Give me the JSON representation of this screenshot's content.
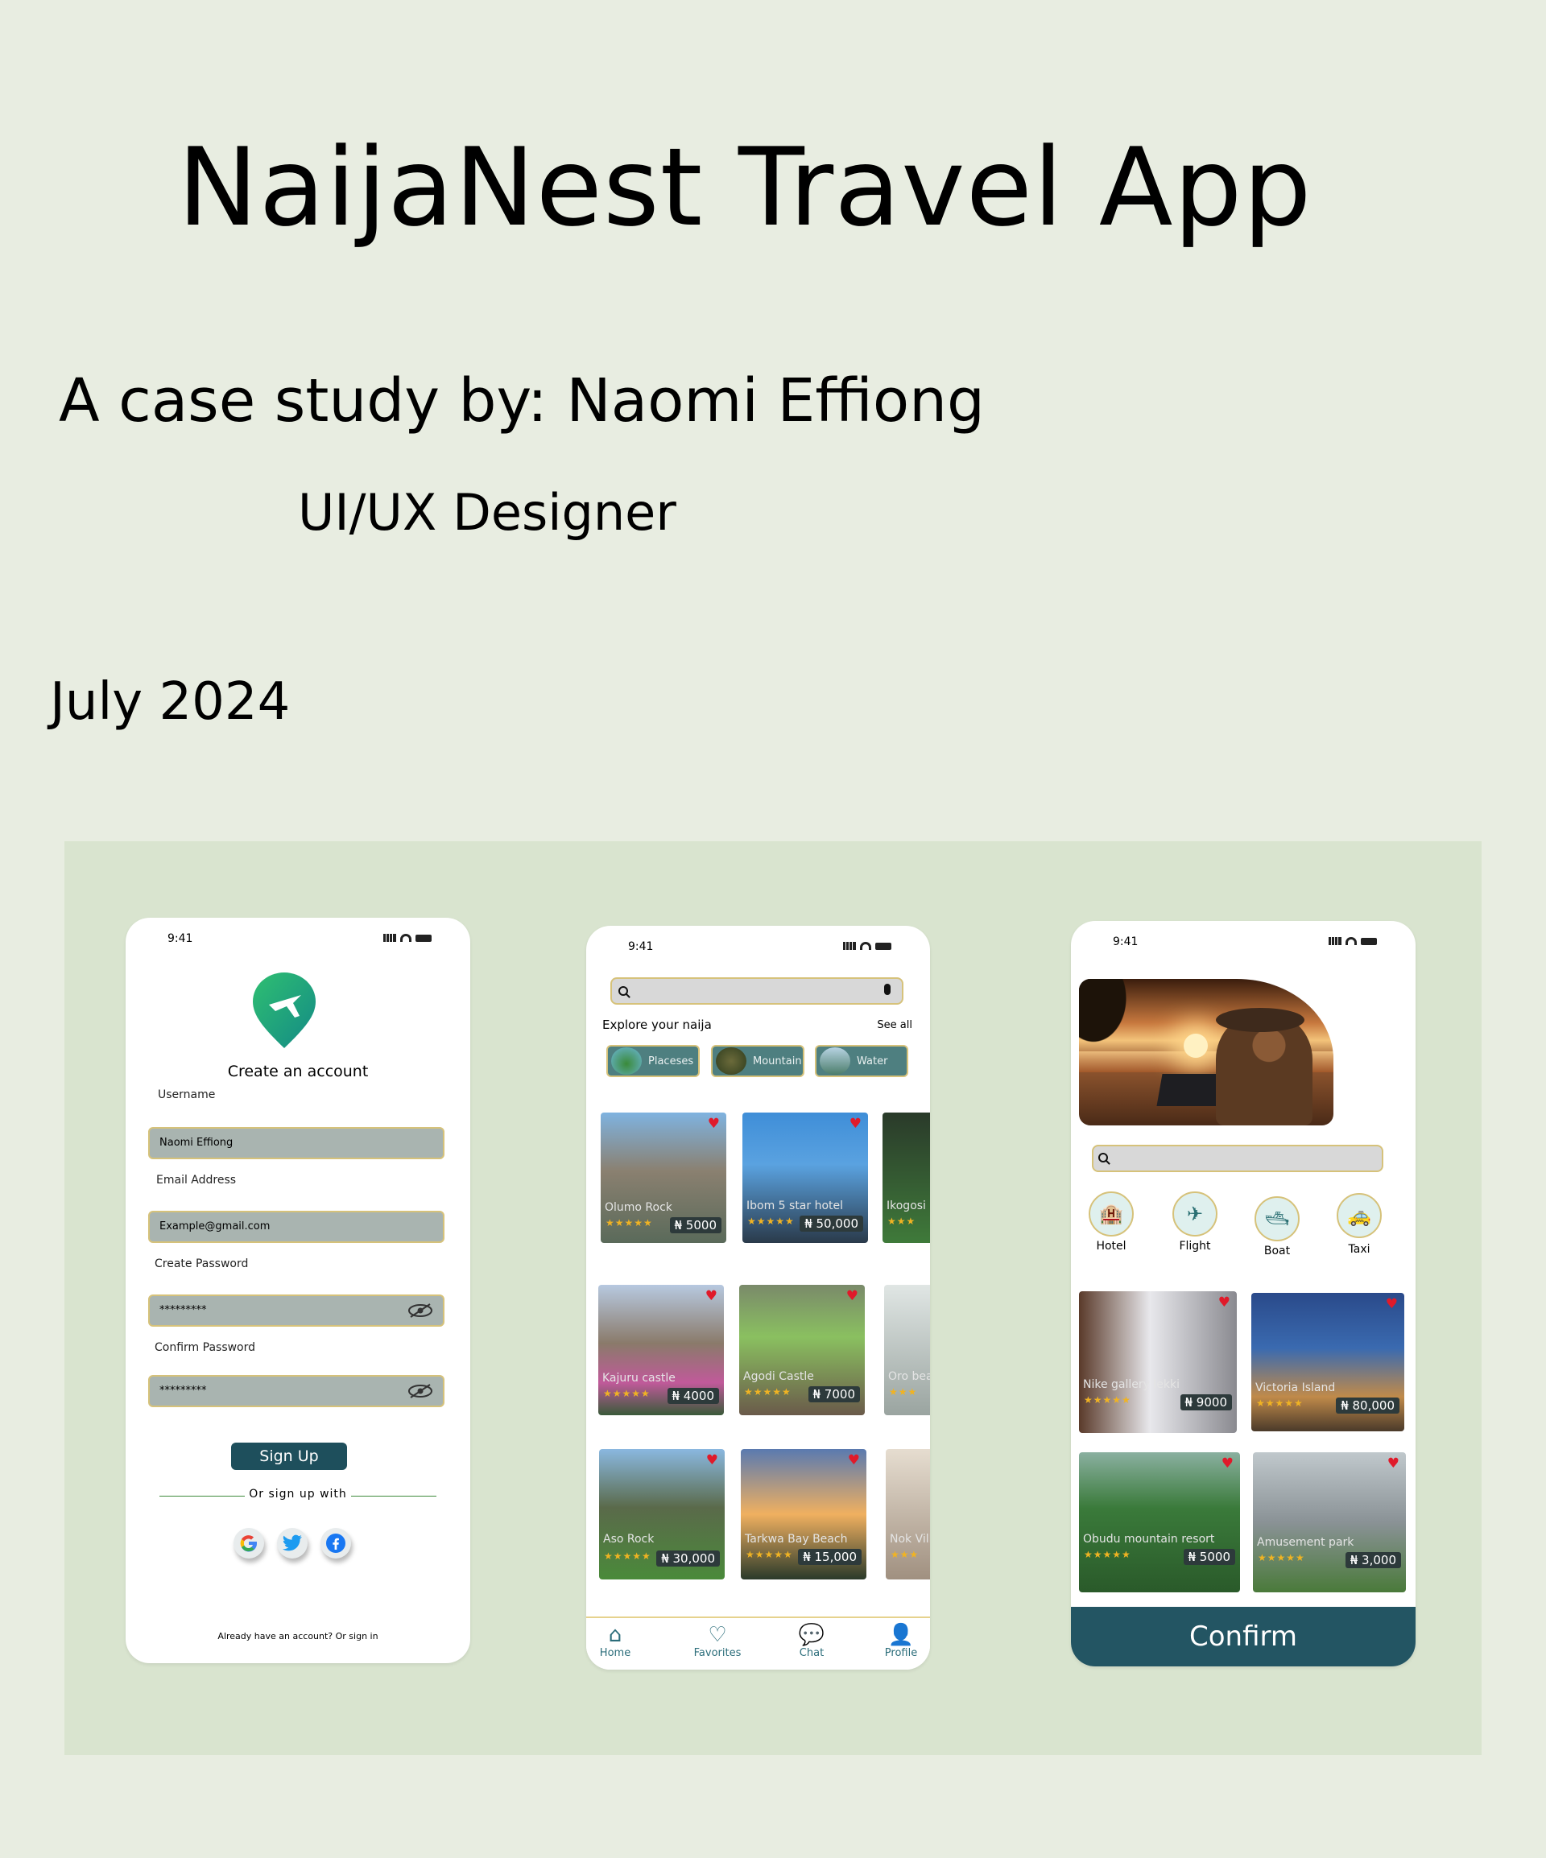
{
  "header": {
    "title": "NaijaNest Travel App",
    "subtitle": "A case study by: Naomi Effiong",
    "role": "UI/UX Designer",
    "date": "July 2024"
  },
  "signup": {
    "time": "9:41",
    "heading": "Create an account",
    "username_label": "Username",
    "username_value": "Naomi Effiong",
    "email_label": "Email Address",
    "email_value": "Example@gmail.com",
    "password_label": "Create Password",
    "password_value": "*********",
    "confirm_label": "Confirm Password",
    "confirm_value": "*********",
    "signup_button": "Sign Up",
    "or_text": "Or sign up with",
    "footer": "Already have an account? Or sign in"
  },
  "home": {
    "time": "9:41",
    "explore": "Explore your naija",
    "see_all": "See all",
    "chips": [
      "Placeses",
      "Mountain",
      "Water"
    ],
    "cards": [
      {
        "name": "Olumo Rock",
        "stars": "★★★★★",
        "price": "₦ 5000"
      },
      {
        "name": "Ibom 5 star hotel",
        "stars": "★★★★★",
        "price": "₦ 50,000"
      },
      {
        "name": "Ikogosi w",
        "stars": "★★★",
        "price": ""
      },
      {
        "name": "Kajuru castle",
        "stars": "★★★★★",
        "price": "₦ 4000"
      },
      {
        "name": "Agodi Castle",
        "stars": "★★★★★",
        "price": "₦ 7000"
      },
      {
        "name": "Oro bea",
        "stars": "★★★",
        "price": ""
      },
      {
        "name": "Aso Rock",
        "stars": "★★★★★",
        "price": "₦ 30,000"
      },
      {
        "name": "Tarkwa Bay Beach",
        "stars": "★★★★★",
        "price": "₦ 15,000"
      },
      {
        "name": "Nok Vill",
        "stars": "★★★",
        "price": ""
      }
    ],
    "nav": [
      "Home",
      "Favorites",
      "Chat",
      "Profile"
    ]
  },
  "booking": {
    "time": "9:41",
    "services": [
      "Hotel",
      "Flight",
      "Boat",
      "Taxi"
    ],
    "cards": [
      {
        "name": "Nike gallery lekki",
        "stars": "★★★★★",
        "price": "₦ 9000"
      },
      {
        "name": "Victoria Island",
        "stars": "★★★★★",
        "price": "₦ 80,000"
      },
      {
        "name": "Obudu mountain resort",
        "stars": "★★★★★",
        "price": "₦ 5000"
      },
      {
        "name": "Amusement park",
        "stars": "★★★★★",
        "price": "₦ 3,000"
      }
    ],
    "confirm_button": "Confirm"
  },
  "colors": {
    "background": "#e8ede1",
    "panel": "#d9e4cf",
    "primary": "#1e4f5c",
    "accent_border": "#d6c27a",
    "heart": "#e01a2a",
    "star": "#f0b323"
  }
}
